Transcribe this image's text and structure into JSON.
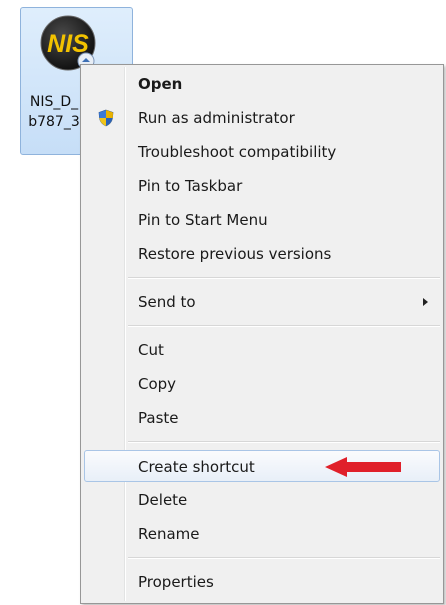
{
  "desktop_icon": {
    "logo_text": "NIS",
    "label_line1": "NIS_D_",
    "label_line2": "b787_3"
  },
  "context_menu": {
    "items": [
      {
        "label": "Open",
        "bold": true
      },
      {
        "label": "Run as administrator",
        "icon": "uac-shield-icon"
      },
      {
        "label": "Troubleshoot compatibility"
      },
      {
        "label": "Pin to Taskbar"
      },
      {
        "label": "Pin to Start Menu"
      },
      {
        "label": "Restore previous versions"
      },
      {
        "label": "Send to",
        "has_submenu": true
      },
      {
        "label": "Cut"
      },
      {
        "label": "Copy"
      },
      {
        "label": "Paste"
      },
      {
        "label": "Create shortcut",
        "highlighted": true,
        "annotation": "red-arrow-icon"
      },
      {
        "label": "Delete"
      },
      {
        "label": "Rename"
      },
      {
        "label": "Properties"
      }
    ]
  },
  "colors": {
    "menu_background": "#f0f0f0",
    "menu_border": "#979797",
    "highlight_border": "#a9c5e6",
    "selection_background": "#c6def7",
    "annotation_arrow": "#e0202a",
    "logo_text": "#f2c200"
  }
}
